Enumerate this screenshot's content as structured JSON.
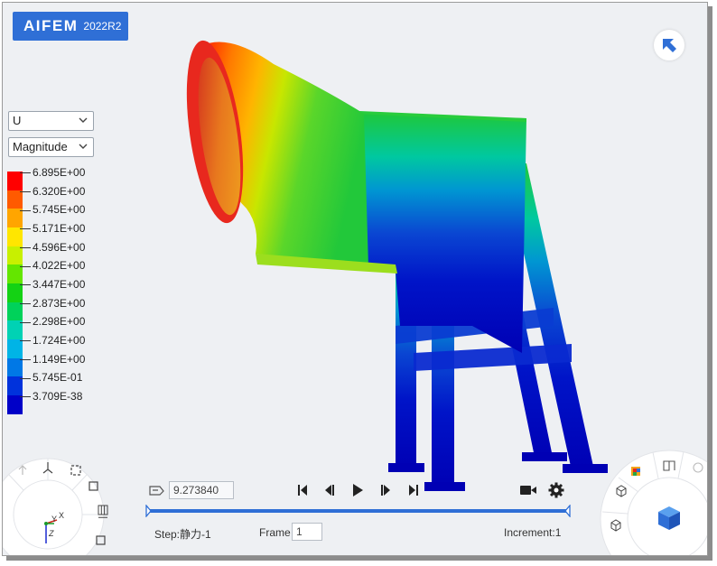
{
  "app": {
    "brand": "AIFEM",
    "version": "2022R2"
  },
  "result": {
    "variable": "U",
    "component": "Magnitude",
    "legend_colors": [
      "#ff0000",
      "#ff5a00",
      "#ffa500",
      "#ffe600",
      "#c8f000",
      "#64e600",
      "#14d214",
      "#00d25a",
      "#00d2b4",
      "#00b4e6",
      "#0078e6",
      "#0032dc",
      "#0000c8"
    ],
    "legend_labels": [
      "6.895E+00",
      "6.320E+00",
      "5.745E+00",
      "5.171E+00",
      "4.596E+00",
      "4.022E+00",
      "3.447E+00",
      "2.873E+00",
      "2.298E+00",
      "1.724E+00",
      "1.149E+00",
      "5.745E-01",
      "3.709E-38"
    ]
  },
  "playback": {
    "time_value": "9.273840",
    "step_label": "Step:静力-1",
    "frame_label": "Frame",
    "frame_value": "1",
    "increment_label": "Increment:1"
  },
  "triad": {
    "x": "X",
    "y": "Y",
    "z": "Z"
  },
  "icons": {
    "nav": "select-arrow-icon",
    "left_wheel": [
      "rotate-icon",
      "axis-icon",
      "fit-view-icon",
      "zoom-box-icon",
      "grid-icon",
      "zoom-region-icon"
    ],
    "right_wheel": [
      "color-cube-icon",
      "split-view-icon",
      "light-icon",
      "wire-cube-icon",
      "iso-cube-icon",
      "view-cube-icon"
    ],
    "playback": [
      "first-frame-icon",
      "prev-frame-icon",
      "play-icon",
      "next-frame-icon",
      "last-frame-icon",
      "record-icon",
      "settings-icon"
    ]
  }
}
